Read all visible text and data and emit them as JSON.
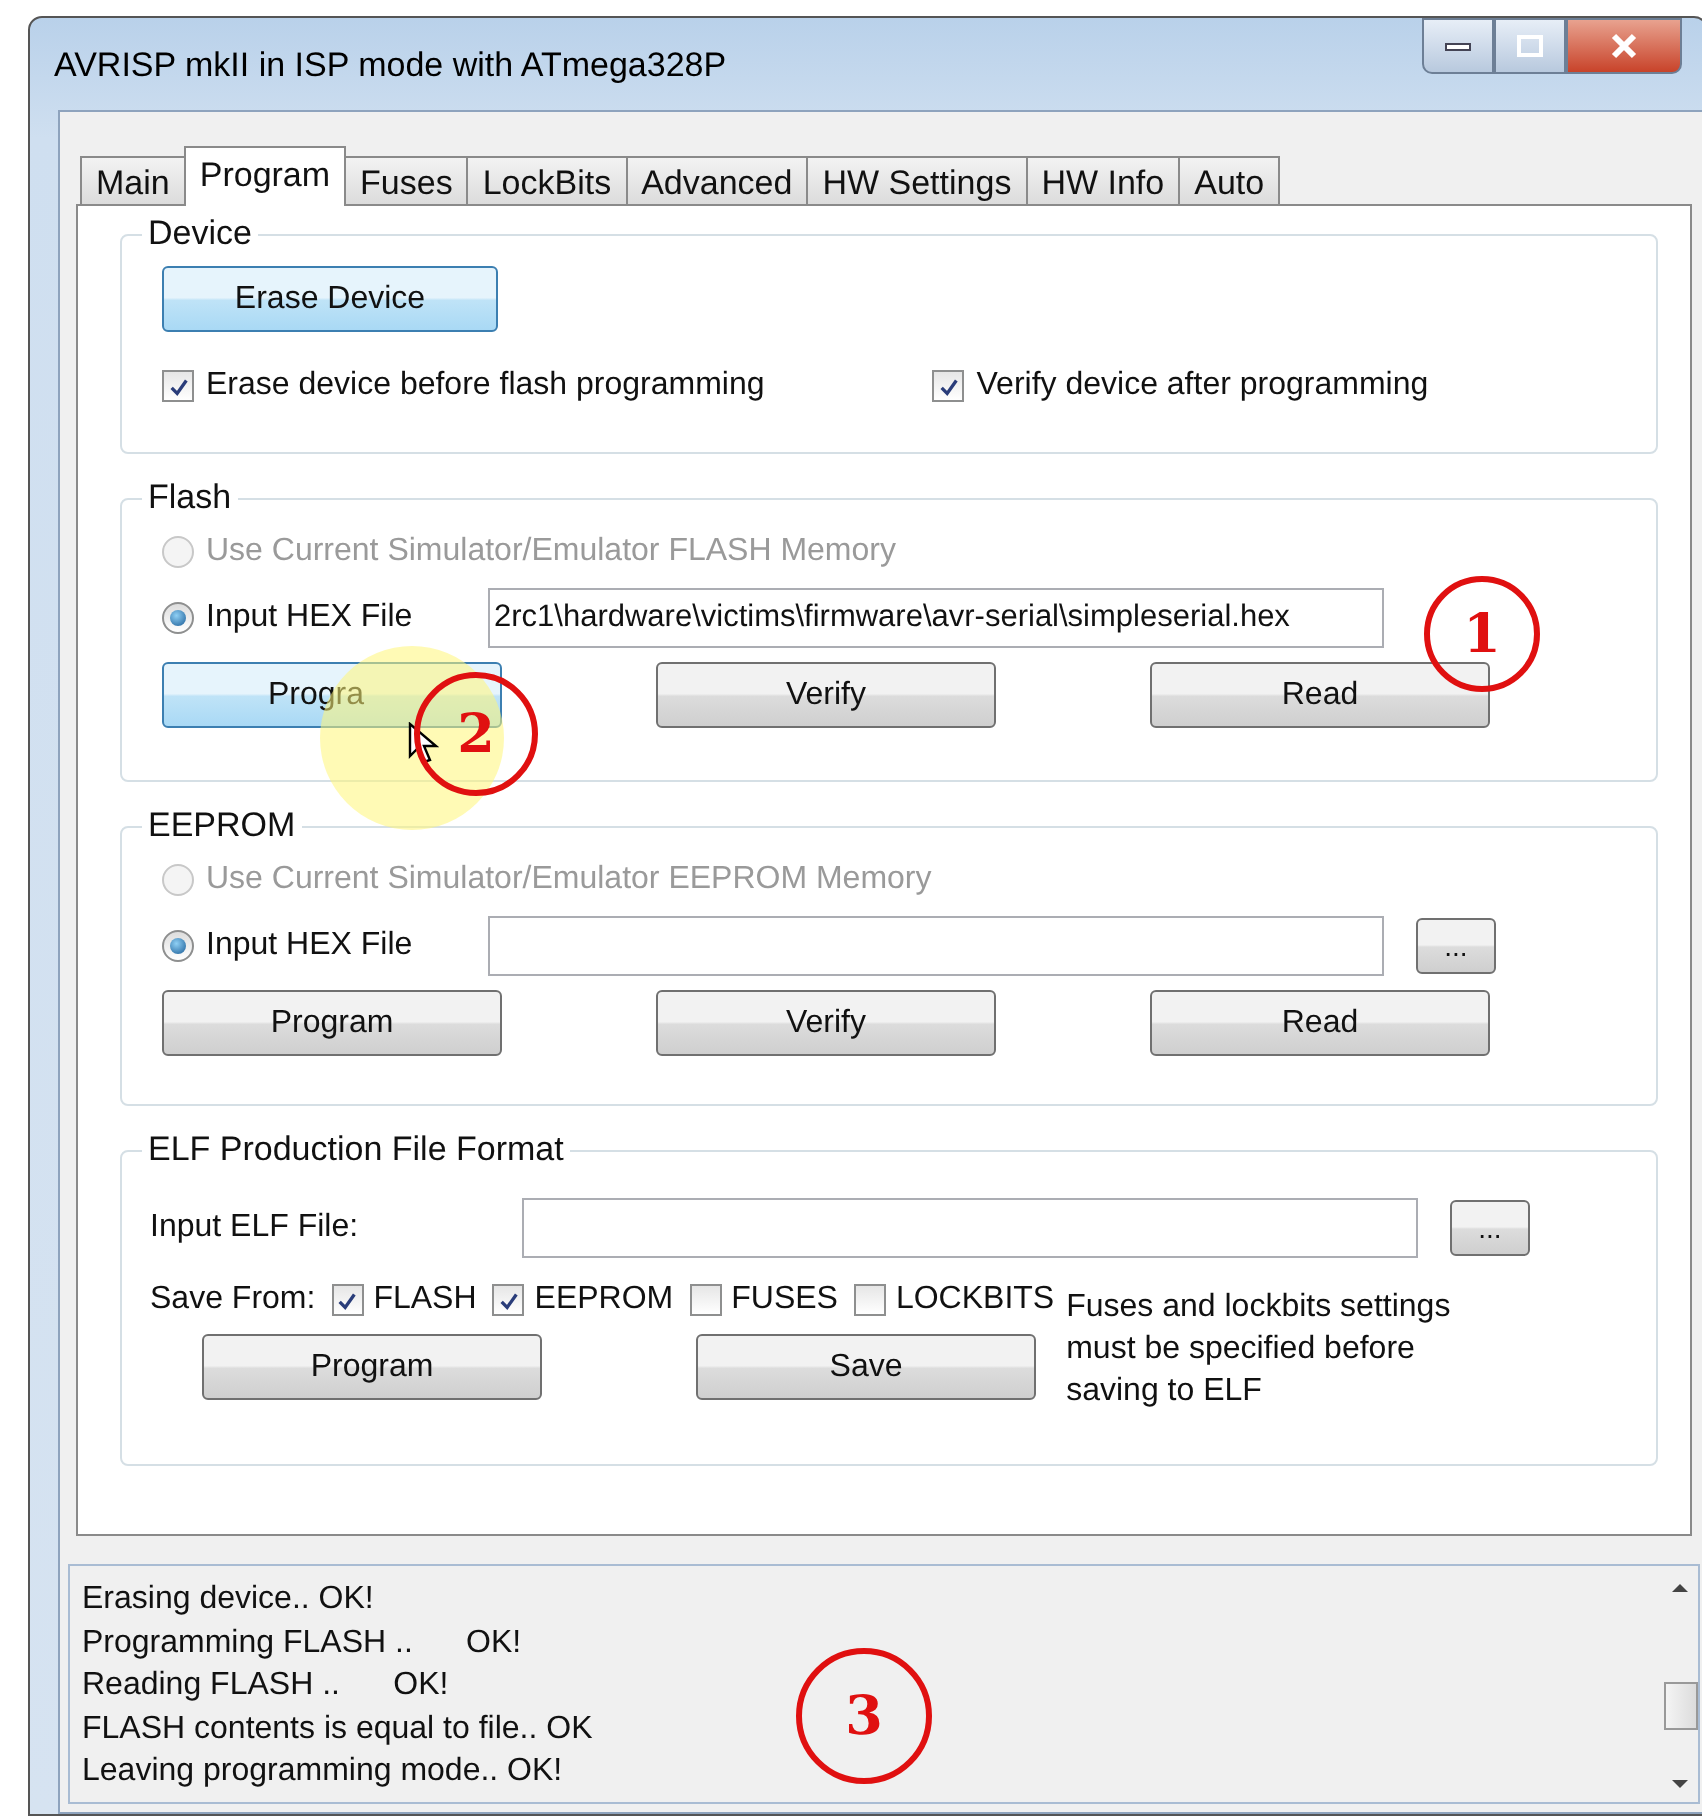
{
  "window": {
    "title": "AVRISP mkII in ISP mode with ATmega328P"
  },
  "tabs": [
    {
      "label": "Main",
      "selected": false
    },
    {
      "label": "Program",
      "selected": true
    },
    {
      "label": "Fuses",
      "selected": false
    },
    {
      "label": "LockBits",
      "selected": false
    },
    {
      "label": "Advanced",
      "selected": false
    },
    {
      "label": "HW Settings",
      "selected": false
    },
    {
      "label": "HW Info",
      "selected": false
    },
    {
      "label": "Auto",
      "selected": false
    }
  ],
  "device": {
    "title": "Device",
    "erase_button": "Erase Device",
    "options": [
      {
        "label": "Erase device before flash programming",
        "checked": true
      },
      {
        "label": "Verify device after programming",
        "checked": true
      }
    ]
  },
  "flash": {
    "title": "Flash",
    "sources": [
      {
        "label": "Use Current Simulator/Emulator FLASH Memory",
        "selected": false,
        "disabled": true
      },
      {
        "label": "Input HEX File",
        "selected": true,
        "disabled": false
      }
    ],
    "file_value": "2rc1\\hardware\\victims\\firmware\\avr-serial\\simpleserial.hex",
    "browse_annotation": "1",
    "program_annotation": "2",
    "buttons": [
      "Progra",
      "Verify",
      "Read"
    ]
  },
  "eeprom": {
    "title": "EEPROM",
    "sources": [
      {
        "label": "Use Current Simulator/Emulator EEPROM Memory",
        "selected": false,
        "disabled": true
      },
      {
        "label": "Input HEX File",
        "selected": true,
        "disabled": false
      }
    ],
    "browse": "...",
    "buttons": [
      "Program",
      "Verify",
      "Read"
    ]
  },
  "elf": {
    "title": "ELF Production File Format",
    "input_label": "Input ELF File:",
    "browse": "...",
    "save_from_label": "Save From:",
    "checks": [
      {
        "label": "FLASH",
        "checked": true
      },
      {
        "label": "EEPROM",
        "checked": true
      },
      {
        "label": "FUSES",
        "checked": false
      },
      {
        "label": "LOCKBITS",
        "checked": false
      }
    ],
    "buttons": [
      "Program",
      "Save"
    ],
    "note": "Fuses and lockbits settings must be specified before saving to ELF"
  },
  "log": {
    "lines": [
      "Erasing device.. OK!",
      "Programming FLASH ..      OK!",
      "Reading FLASH ..      OK!",
      "FLASH contents is equal to file.. OK",
      "Leaving programming mode.. OK!"
    ],
    "annotation": "3"
  }
}
